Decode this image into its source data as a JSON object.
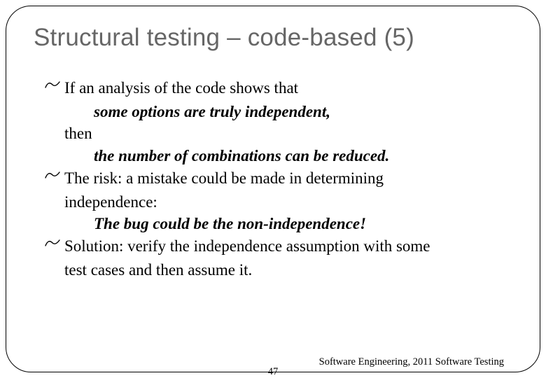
{
  "title": "Structural testing – code-based (5)",
  "content": {
    "b1": "If an analysis of the code shows that",
    "em1": "some options are truly  independent,",
    "then": "then",
    "em2": "the number of combinations can be reduced.",
    "b2a": "The risk: a mistake could be made in determining",
    "b2b": "independence:",
    "em3": "The bug could be the non-independence!",
    "b3a": "Solution: verify the independence assumption with some",
    "b3b": "test cases and then assume it."
  },
  "footer": {
    "text": "Software Engineering,  2011 Software  Testing",
    "page": "47"
  }
}
